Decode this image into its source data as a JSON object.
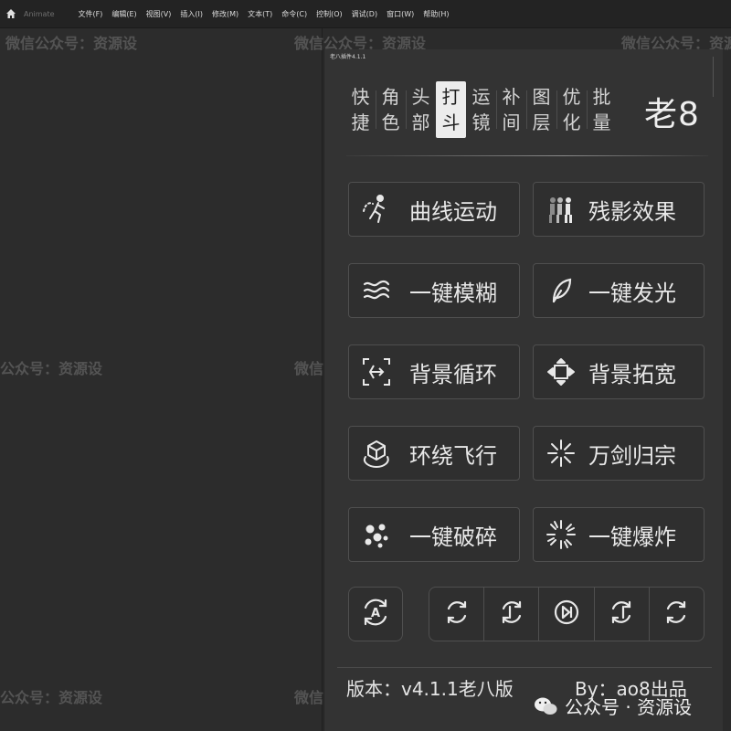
{
  "app": {
    "name": "Animate"
  },
  "menu": [
    "文件(F)",
    "编辑(E)",
    "视图(V)",
    "插入(I)",
    "修改(M)",
    "文本(T)",
    "命令(C)",
    "控制(O)",
    "调试(D)",
    "窗口(W)",
    "帮助(H)"
  ],
  "panel": {
    "title": "老八插件4.1.1",
    "brand": "老8",
    "tabs": [
      {
        "top": "快",
        "bottom": "捷"
      },
      {
        "top": "角",
        "bottom": "色"
      },
      {
        "top": "头",
        "bottom": "部"
      },
      {
        "top": "打",
        "bottom": "斗"
      },
      {
        "top": "运",
        "bottom": "镜"
      },
      {
        "top": "补",
        "bottom": "间"
      },
      {
        "top": "图",
        "bottom": "层"
      },
      {
        "top": "优",
        "bottom": "化"
      },
      {
        "top": "批",
        "bottom": "量"
      }
    ],
    "active_tab": "打斗",
    "effects": [
      {
        "label": "曲线运动",
        "icon": "running-figure-icon"
      },
      {
        "label": "残影效果",
        "icon": "afterimage-figures-icon"
      },
      {
        "label": "一键模糊",
        "icon": "blur-waves-icon"
      },
      {
        "label": "一键发光",
        "icon": "glow-feather-icon"
      },
      {
        "label": "背景循环",
        "icon": "background-loop-icon"
      },
      {
        "label": "背景拓宽",
        "icon": "background-expand-icon"
      },
      {
        "label": "环绕飞行",
        "icon": "orbit-cube-icon"
      },
      {
        "label": "万剑归宗",
        "icon": "converging-swords-icon"
      },
      {
        "label": "一键破碎",
        "icon": "shatter-icon"
      },
      {
        "label": "一键爆炸",
        "icon": "explosion-icon"
      }
    ],
    "auto_button_icon": "auto-cycle-icon",
    "auto_letter": "A",
    "loop_buttons": [
      "loop-icon",
      "loop-left-icon",
      "play-next-icon",
      "loop-right-icon",
      "loop-alt-icon"
    ],
    "version": "版本：v4.1.1老八版",
    "author": "By：ao8出品"
  },
  "watermarks": {
    "small": "微信公众号：资源设",
    "left": "公众号：资源设",
    "wechat": "公众号 · 资源设"
  },
  "colors": {
    "background": "#2b2b2b",
    "panel": "#333333",
    "active_tab": "#ececec",
    "border": "#4f4f4f"
  }
}
